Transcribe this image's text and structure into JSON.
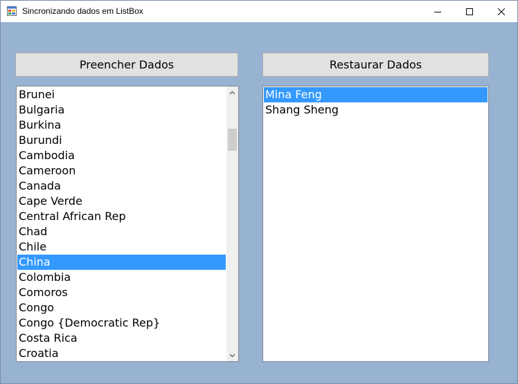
{
  "window": {
    "title": "Sincronizando dados em ListBox"
  },
  "buttons": {
    "fill_label": "Preencher Dados",
    "restore_label": "Restaurar Dados"
  },
  "left_list": {
    "items": [
      "Brunei",
      "Bulgaria",
      "Burkina",
      "Burundi",
      "Cambodia",
      "Cameroon",
      "Canada",
      "Cape Verde",
      "Central African Rep",
      "Chad",
      "Chile",
      "China",
      "Colombia",
      "Comoros",
      "Congo",
      "Congo {Democratic Rep}",
      "Costa Rica",
      "Croatia"
    ],
    "selected": "China"
  },
  "right_list": {
    "items": [
      "Mina Feng",
      "Shang Sheng"
    ],
    "selected": "Mina Feng"
  },
  "colors": {
    "background": "#98b2d2",
    "selection": "#3399ff",
    "button_face": "#e1e1e1"
  }
}
